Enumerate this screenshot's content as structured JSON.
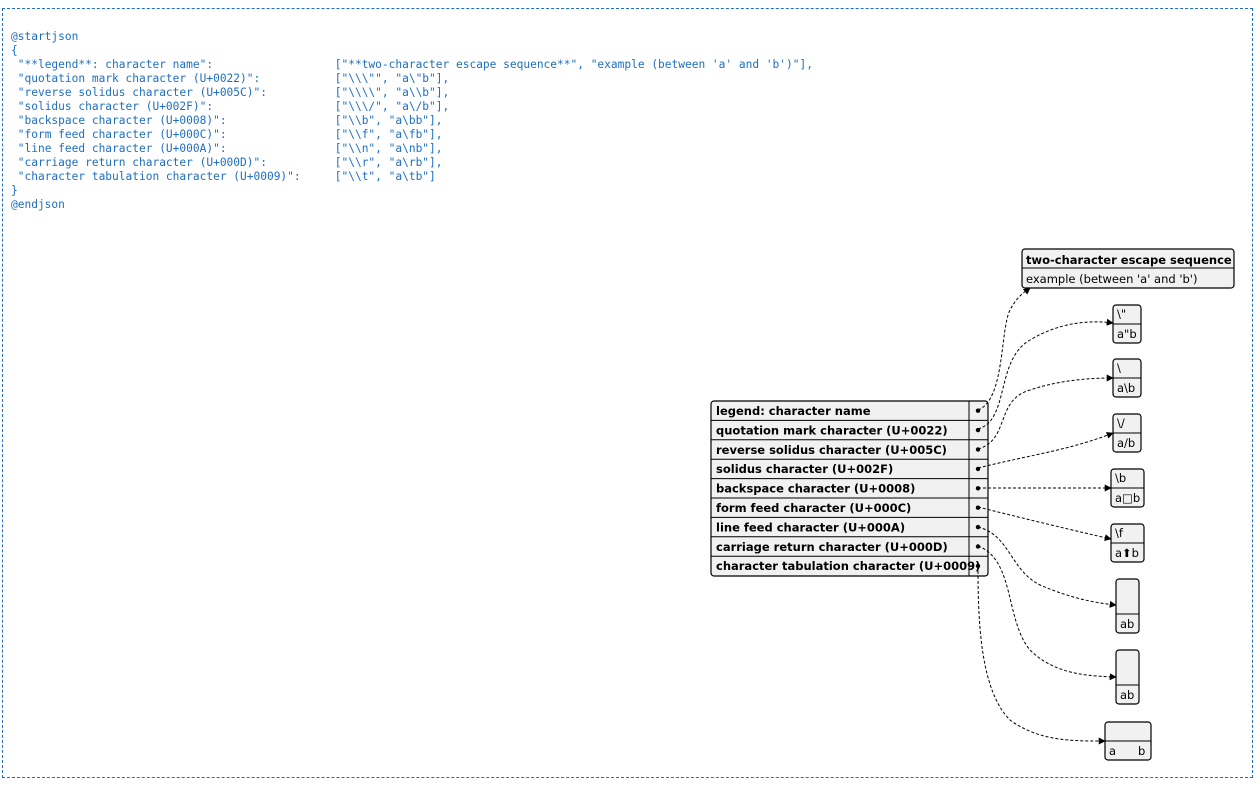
{
  "source": {
    "start": "@startjson",
    "open": "{",
    "entries": [
      {
        "key": "\"**legend**: character name\":",
        "value": "[\"**two-character escape sequence**\", \"example (between 'a' and 'b')\"],"
      },
      {
        "key": "\"quotation mark character (U+0022)\":",
        "value": "[\"\\\\\\\"\", \"a\\\"b\"],"
      },
      {
        "key": "\"reverse solidus character (U+005C)\":",
        "value": "[\"\\\\\\\\\", \"a\\\\b\"],"
      },
      {
        "key": "\"solidus character (U+002F)\":",
        "value": "[\"\\\\\\/\", \"a\\/b\"],"
      },
      {
        "key": "\"backspace character (U+0008)\":",
        "value": "[\"\\\\b\", \"a\\bb\"],"
      },
      {
        "key": "\"form feed character (U+000C)\":",
        "value": "[\"\\\\f\", \"a\\fb\"],"
      },
      {
        "key": "\"line feed character (U+000A)\":",
        "value": "[\"\\\\n\", \"a\\nb\"],"
      },
      {
        "key": "\"carriage return character (U+000D)\":",
        "value": "[\"\\\\r\", \"a\\rb\"],"
      },
      {
        "key": "\"character tabulation character (U+0009)\":",
        "value": "[\"\\\\t\", \"a\\tb\"]"
      }
    ],
    "close": "}",
    "end": "@endjson"
  },
  "diagram": {
    "table_rows": [
      "legend: character name",
      "quotation mark character (U+0022)",
      "reverse solidus character (U+005C)",
      "solidus character (U+002F)",
      "backspace character (U+0008)",
      "form feed character (U+000C)",
      "line feed character (U+000A)",
      "carriage return character (U+000D)",
      "character tabulation character (U+0009)"
    ],
    "legend_box": {
      "top": "two-character escape sequence",
      "bottom": "example (between 'a' and 'b')"
    },
    "boxes": [
      {
        "top": "\\\"",
        "bottom": "a\"b"
      },
      {
        "top": "\\",
        "bottom": "a\\b"
      },
      {
        "top": "\\/",
        "bottom": "a/b"
      },
      {
        "top": "\\b",
        "bottom": "a□b"
      },
      {
        "top": "\\f",
        "bottom": "a⬆b"
      },
      {
        "top": "",
        "bottom": "ab"
      },
      {
        "top": "",
        "bottom": "ab"
      },
      {
        "top": "",
        "bottom": "a      b"
      }
    ],
    "colors": {
      "line": "#000000",
      "box_fill": "#f1f1f1",
      "frame": "#1f6fbf",
      "source_text": "#1f6fbf"
    }
  }
}
